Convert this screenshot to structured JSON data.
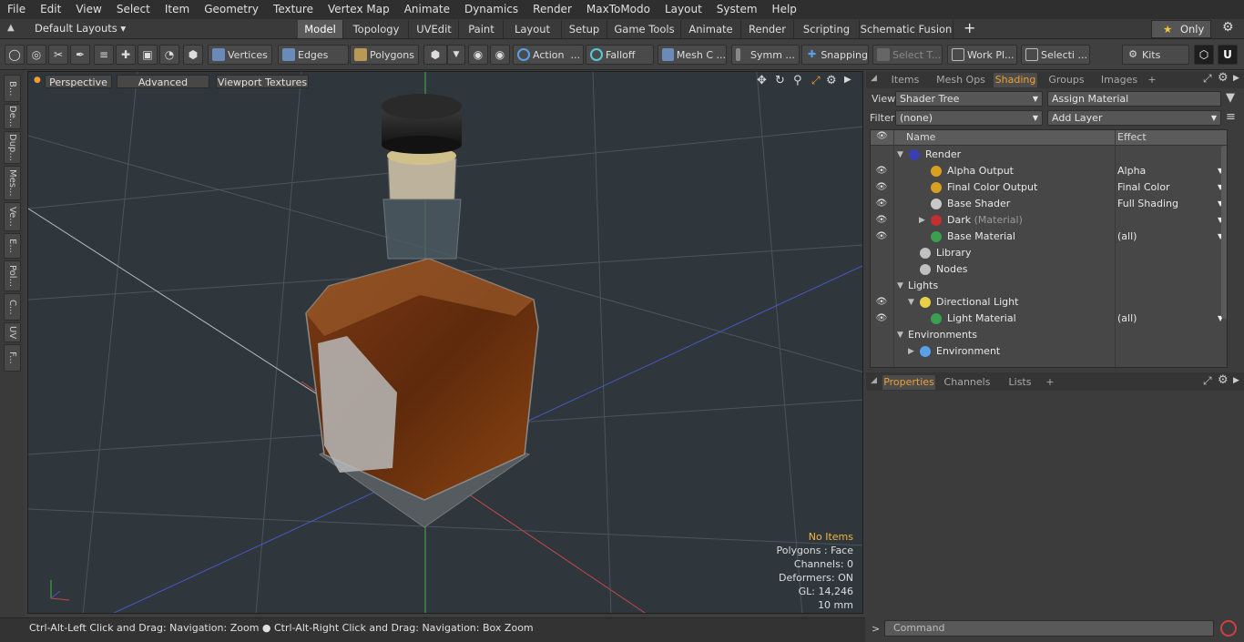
{
  "menu": [
    "File",
    "Edit",
    "View",
    "Select",
    "Item",
    "Geometry",
    "Texture",
    "Vertex Map",
    "Animate",
    "Dynamics",
    "Render",
    "MaxToModo",
    "Layout",
    "System",
    "Help"
  ],
  "layout_bar": {
    "layouts_label": "Default Layouts",
    "tabs": [
      "Model",
      "Topology",
      "UVEdit",
      "Paint",
      "Layout",
      "Setup",
      "Game Tools",
      "Animate",
      "Render",
      "Scripting",
      "Schematic Fusion"
    ],
    "active_tab": "Model",
    "add": "+",
    "only_label": "Only"
  },
  "toolbar": {
    "vertices": "Vertices",
    "edges": "Edges",
    "polygons": "Polygons",
    "action": "Action",
    "falloff": "Falloff",
    "mesh_c": "Mesh C ...",
    "symm": "Symm ...",
    "snapping": "Snapping",
    "select_t": "Select T...",
    "work_pl": "Work Pl...",
    "selecti": "Selecti ...",
    "kits": "Kits"
  },
  "left_tabs": [
    "B...",
    "De...",
    "Dup...",
    "Mes...",
    "Ve...",
    "E...",
    "Pol...",
    "C...",
    "UV",
    "F..."
  ],
  "viewport": {
    "perspective": "Perspective",
    "advanced": "Advanced",
    "viewport_textures": "Viewport Textures",
    "info": {
      "items": "No Items",
      "polygons": "Polygons : Face",
      "channels": "Channels: 0",
      "deformers": "Deformers: ON",
      "gl": "GL: 14,246",
      "scale": "10 mm"
    }
  },
  "statusbar": "Ctrl-Alt-Left Click and Drag: Navigation: Zoom ● Ctrl-Alt-Right Click and Drag: Navigation: Box Zoom",
  "panel_top": {
    "tabs": [
      "Items",
      "Mesh Ops",
      "Shading",
      "Groups",
      "Images"
    ],
    "active_tab": "Shading",
    "add": "+",
    "view_label": "View",
    "view_value": "Shader Tree",
    "assign": "Assign Material",
    "filter_label": "Filter",
    "filter_value": "(none)",
    "add_layer": "Add Layer",
    "col_name": "Name",
    "col_effect": "Effect",
    "rows": [
      {
        "name": "Render",
        "effect": "",
        "eye": false,
        "toggle": "▼",
        "indent": 0,
        "icon": "render-sphere-icon",
        "color": "#3a3fb0"
      },
      {
        "name": "Alpha Output",
        "effect": "Alpha",
        "eye": true,
        "toggle": "",
        "indent": 2,
        "icon": "render-output-icon",
        "color": "#d8a020"
      },
      {
        "name": "Final Color Output",
        "effect": "Final Color",
        "eye": true,
        "toggle": "",
        "indent": 2,
        "icon": "render-output-icon",
        "color": "#d8a020"
      },
      {
        "name": "Base Shader",
        "effect": "Full Shading",
        "eye": true,
        "toggle": "",
        "indent": 2,
        "icon": "shader-icon",
        "color": "#c8c8c8"
      },
      {
        "name": "Dark",
        "suffix": "(Material)",
        "effect": "",
        "eye": true,
        "toggle": "▶",
        "indent": 2,
        "icon": "material-group-icon",
        "color": "#c03030"
      },
      {
        "name": "Base Material",
        "effect": "(all)",
        "eye": true,
        "toggle": "",
        "indent": 2,
        "icon": "material-icon",
        "color": "#3aa050"
      },
      {
        "name": "Library",
        "effect": "",
        "eye": false,
        "toggle": "",
        "indent": 1,
        "icon": "folder-icon",
        "color": "#c0c0c0"
      },
      {
        "name": "Nodes",
        "effect": "",
        "eye": false,
        "toggle": "",
        "indent": 1,
        "icon": "folder-icon",
        "color": "#c0c0c0"
      },
      {
        "name": "Lights",
        "effect": "",
        "eye": false,
        "toggle": "▼",
        "indent": 0,
        "icon": "",
        "color": ""
      },
      {
        "name": "Directional Light",
        "effect": "",
        "eye": true,
        "toggle": "▼",
        "indent": 1,
        "icon": "light-icon",
        "color": "#e8d048"
      },
      {
        "name": "Light Material",
        "effect": "(all)",
        "eye": true,
        "toggle": "",
        "indent": 2,
        "icon": "material-icon",
        "color": "#3aa050"
      },
      {
        "name": "Environments",
        "effect": "",
        "eye": false,
        "toggle": "▼",
        "indent": 0,
        "icon": "",
        "color": ""
      },
      {
        "name": "Environment",
        "effect": "",
        "eye": false,
        "toggle": "▶",
        "indent": 1,
        "icon": "environment-icon",
        "color": "#5aa0e8"
      }
    ]
  },
  "panel_bottom": {
    "tabs": [
      "Properties",
      "Channels",
      "Lists"
    ],
    "active_tab": "Properties",
    "add": "+",
    "command_placeholder": "Command",
    "prompt": ">"
  },
  "colors": {
    "accent": "#f0a030",
    "active_tab": "#5a5a5a",
    "viewport_bg": "#2f373d"
  }
}
